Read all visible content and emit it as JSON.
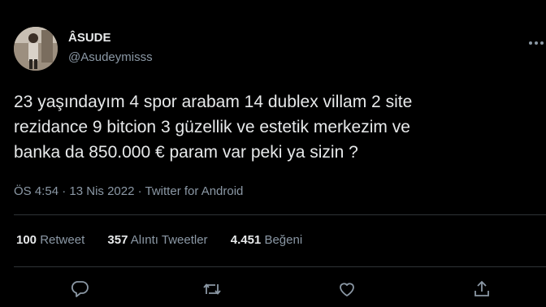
{
  "tweet": {
    "author": {
      "display_name": "ÂSUDE",
      "handle": "@Asudeymisss"
    },
    "text": "23 yaşındayım 4 spor arabam 14 dublex villam 2 site\nrezidance 9 bitcion 3 güzellik ve estetik merkezim ve\nbanka da 850.000 € param var peki ya sizin ?",
    "meta": {
      "time": "ÖS 4:54",
      "separator": " · ",
      "date": "13 Nis 2022",
      "client": "Twitter for Android"
    },
    "stats": [
      {
        "count": "100",
        "label": "Retweet"
      },
      {
        "count": "357",
        "label": "Alıntı Tweetler"
      },
      {
        "count": "4.451",
        "label": "Beğeni"
      }
    ],
    "actions": [
      "reply-icon",
      "retweet-icon",
      "like-icon",
      "share-icon"
    ]
  },
  "theme": {
    "background": "#000000",
    "primary_text": "#e7e9ea",
    "secondary_text": "#8b98a5",
    "divider": "#2f3336"
  }
}
